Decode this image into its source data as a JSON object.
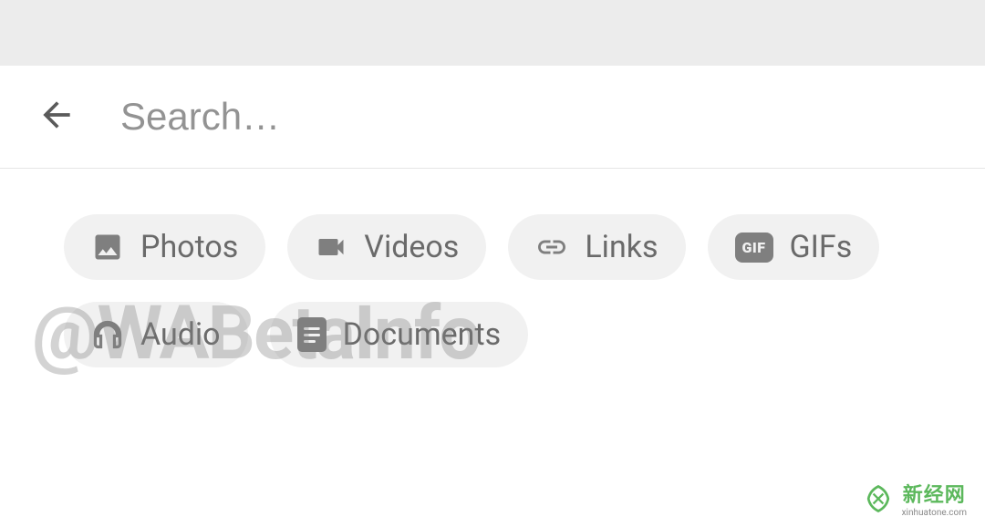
{
  "search": {
    "placeholder": "Search…"
  },
  "chips": {
    "photos": "Photos",
    "videos": "Videos",
    "links": "Links",
    "gifs": "GIFs",
    "gif_badge": "GIF",
    "audio": "Audio",
    "documents": "Documents"
  },
  "watermark": "@WABetaInfo",
  "branding": {
    "name": "新经网",
    "url": "xinhuatone.com"
  }
}
